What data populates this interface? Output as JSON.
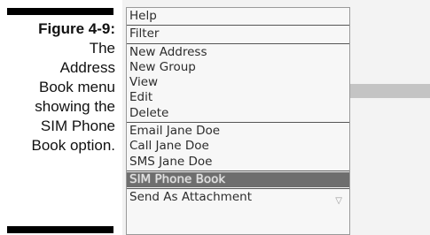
{
  "caption": {
    "figure": "Figure 4-9:",
    "lines": [
      "The",
      "Address",
      "Book menu",
      "showing the",
      "SIM Phone",
      "Book option."
    ]
  },
  "menu": {
    "groups": [
      {
        "items": [
          "Help"
        ]
      },
      {
        "items": [
          "Filter"
        ]
      },
      {
        "items": [
          "New Address",
          "New Group",
          "View",
          "Edit",
          "Delete"
        ]
      },
      {
        "items": [
          "Email Jane Doe",
          "Call Jane Doe",
          "SMS Jane Doe"
        ]
      },
      {
        "items": [
          "SIM Phone Book"
        ]
      },
      {
        "items": [
          "Send As Attachment"
        ]
      }
    ],
    "selected": "SIM Phone Book",
    "scroll_indicator": "▽"
  },
  "colors": {
    "selected_bg": "#6e6e6e",
    "menu_bg": "#f7f7f7",
    "separator": "#555555"
  }
}
